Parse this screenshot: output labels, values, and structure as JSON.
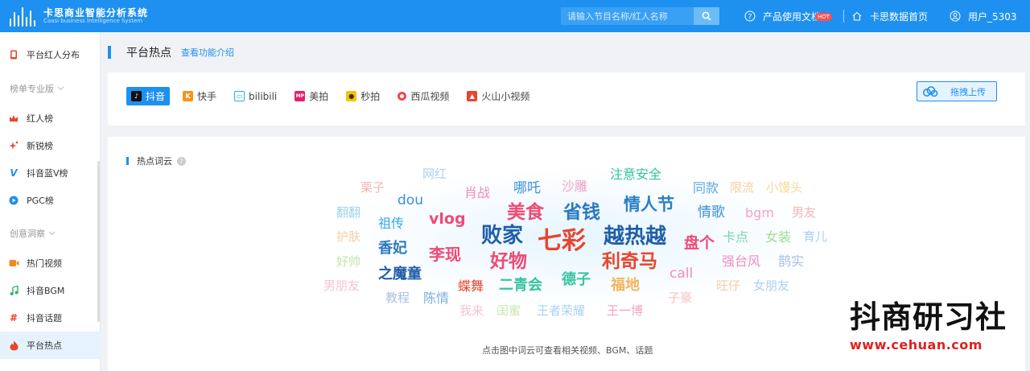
{
  "app": {
    "title": "卡思商业智能分析系统",
    "subtitle": "Caasi business Intelligence System"
  },
  "topbar": {
    "search_placeholder": "请输入节目名称/红人名称",
    "docs_label": "产品使用文档",
    "docs_badge": "HOT",
    "home_label": "卡思数据首页",
    "user_label": "用户_5303"
  },
  "sidebar": {
    "items_top": [
      {
        "label": "平台红人分布",
        "icon": "phone-icon",
        "color": "#e8452c"
      }
    ],
    "group1": "榜单专业版",
    "group1_items": [
      {
        "label": "红人榜",
        "icon": "crown-icon",
        "color": "#e8452c"
      },
      {
        "label": "新锐榜",
        "icon": "sparkle-icon",
        "color": "#e8452c"
      },
      {
        "label": "抖音蓝V榜",
        "icon": "v-icon",
        "color": "#1e90f0"
      },
      {
        "label": "PGC榜",
        "icon": "play-circle-icon",
        "color": "#1e90f0"
      }
    ],
    "group2": "创意洞察",
    "group2_items": [
      {
        "label": "热门视频",
        "icon": "video-icon",
        "color": "#f08a24"
      },
      {
        "label": "抖音BGM",
        "icon": "music-icon",
        "color": "#2bb673"
      },
      {
        "label": "抖音话题",
        "icon": "hashtag-icon",
        "color": "#e8452c"
      },
      {
        "label": "平台热点",
        "icon": "fire-icon",
        "color": "#e8452c"
      }
    ]
  },
  "header": {
    "title": "平台热点",
    "link": "查看功能介绍"
  },
  "platforms": {
    "tabs": [
      {
        "label": "抖音",
        "icon": "douyin-icon",
        "color": "#111",
        "active": true
      },
      {
        "label": "快手",
        "icon": "kuaishou-icon",
        "color": "#f7941d",
        "active": false
      },
      {
        "label": "bilibili",
        "icon": "bilibili-icon",
        "color": "#23ade5",
        "active": false
      },
      {
        "label": "美拍",
        "icon": "meipai-icon",
        "color": "#e4206b",
        "active": false
      },
      {
        "label": "秒拍",
        "icon": "miaopai-icon",
        "color": "#f5c400",
        "active": false
      },
      {
        "label": "西瓜视频",
        "icon": "xigua-icon",
        "color": "#f04848",
        "active": false
      },
      {
        "label": "火山小视频",
        "icon": "huoshan-icon",
        "color": "#e8452c",
        "active": false
      }
    ],
    "upload_label": "拖拽上传"
  },
  "cloud": {
    "section_title": "热点词云",
    "hint": "点击图中词云可查看相关视频、BGM、话题",
    "words": [
      {
        "text": "网红",
        "color": "#a9d2f0",
        "size": 15
      },
      {
        "text": "注意安全",
        "color": "#34c4a0",
        "size": 16
      },
      {
        "text": "栗子",
        "color": "#f5b5b5",
        "size": 15
      },
      {
        "text": "肖战",
        "color": "#f28cc0",
        "size": 16
      },
      {
        "text": "哪吒",
        "color": "#3c8fd8",
        "size": 17
      },
      {
        "text": "沙雕",
        "color": "#f2a2c8",
        "size": 16
      },
      {
        "text": "同款",
        "color": "#5aa8e6",
        "size": 16
      },
      {
        "text": "限流",
        "color": "#f6cfa2",
        "size": 15
      },
      {
        "text": "小馒头",
        "color": "#f6d89a",
        "size": 15
      },
      {
        "text": "dou",
        "color": "#3c8fd8",
        "size": 17
      },
      {
        "text": "情人节",
        "color": "#2a7fc4",
        "size": 21
      },
      {
        "text": "美食",
        "color": "#ef4b75",
        "size": 23
      },
      {
        "text": "省钱",
        "color": "#2a78c0",
        "size": 23
      },
      {
        "text": "翻翻",
        "color": "#9cd3ec",
        "size": 15
      },
      {
        "text": "祖传",
        "color": "#3aa6e0",
        "size": 16
      },
      {
        "text": "vlog",
        "color": "#ef4b75",
        "size": 19
      },
      {
        "text": "情歌",
        "color": "#3c8fd8",
        "size": 17
      },
      {
        "text": "bgm",
        "color": "#f2a2c8",
        "size": 16
      },
      {
        "text": "男友",
        "color": "#f5b5b5",
        "size": 15
      },
      {
        "text": "护肤",
        "color": "#f6cfa2",
        "size": 15
      },
      {
        "text": "败家",
        "color": "#1f5ea8",
        "size": 26
      },
      {
        "text": "七彩",
        "color": "#e8452c",
        "size": 30
      },
      {
        "text": "越热越",
        "color": "#1f5ea8",
        "size": 26
      },
      {
        "text": "盘个",
        "color": "#ef4b75",
        "size": 19
      },
      {
        "text": "卡点",
        "color": "#7cd6b0",
        "size": 16
      },
      {
        "text": "女装",
        "color": "#a0dc8c",
        "size": 16
      },
      {
        "text": "育儿",
        "color": "#a9d2f0",
        "size": 15
      },
      {
        "text": "香妃",
        "color": "#2a78c0",
        "size": 18
      },
      {
        "text": "李现",
        "color": "#ef4b75",
        "size": 20
      },
      {
        "text": "好物",
        "color": "#ef4b75",
        "size": 23
      },
      {
        "text": "利奇马",
        "color": "#e8452c",
        "size": 23
      },
      {
        "text": "强台风",
        "color": "#f28cc0",
        "size": 16
      },
      {
        "text": "鹊实",
        "color": "#a9c0e6",
        "size": 16
      },
      {
        "text": "好帅",
        "color": "#c2e6a8",
        "size": 15
      },
      {
        "text": "之魔童",
        "color": "#1f5ea8",
        "size": 18
      },
      {
        "text": "call",
        "color": "#f28cc0",
        "size": 17
      },
      {
        "text": "德子",
        "color": "#34c4a0",
        "size": 18
      },
      {
        "text": "男朋友",
        "color": "#f5c4d4",
        "size": 15
      },
      {
        "text": "蝶舞",
        "color": "#e8452c",
        "size": 16
      },
      {
        "text": "二青会",
        "color": "#34c4a0",
        "size": 18
      },
      {
        "text": "福地",
        "color": "#f5b45c",
        "size": 18
      },
      {
        "text": "旺仔",
        "color": "#f6cfa2",
        "size": 15
      },
      {
        "text": "女朋友",
        "color": "#a9d2f0",
        "size": 15
      },
      {
        "text": "教程",
        "color": "#a9c0e6",
        "size": 15
      },
      {
        "text": "陈情",
        "color": "#7aaedc",
        "size": 16
      },
      {
        "text": "子豪",
        "color": "#f5c4c4",
        "size": 15
      },
      {
        "text": "我来",
        "color": "#f5c4d4",
        "size": 15
      },
      {
        "text": "闺蜜",
        "color": "#c8e6a8",
        "size": 15
      },
      {
        "text": "王者荣耀",
        "color": "#a9d2f0",
        "size": 15
      },
      {
        "text": "王一博",
        "color": "#f2a2c8",
        "size": 15
      }
    ]
  },
  "watermark": {
    "title": "抖商研习社",
    "url": "www.cehuan.com"
  }
}
